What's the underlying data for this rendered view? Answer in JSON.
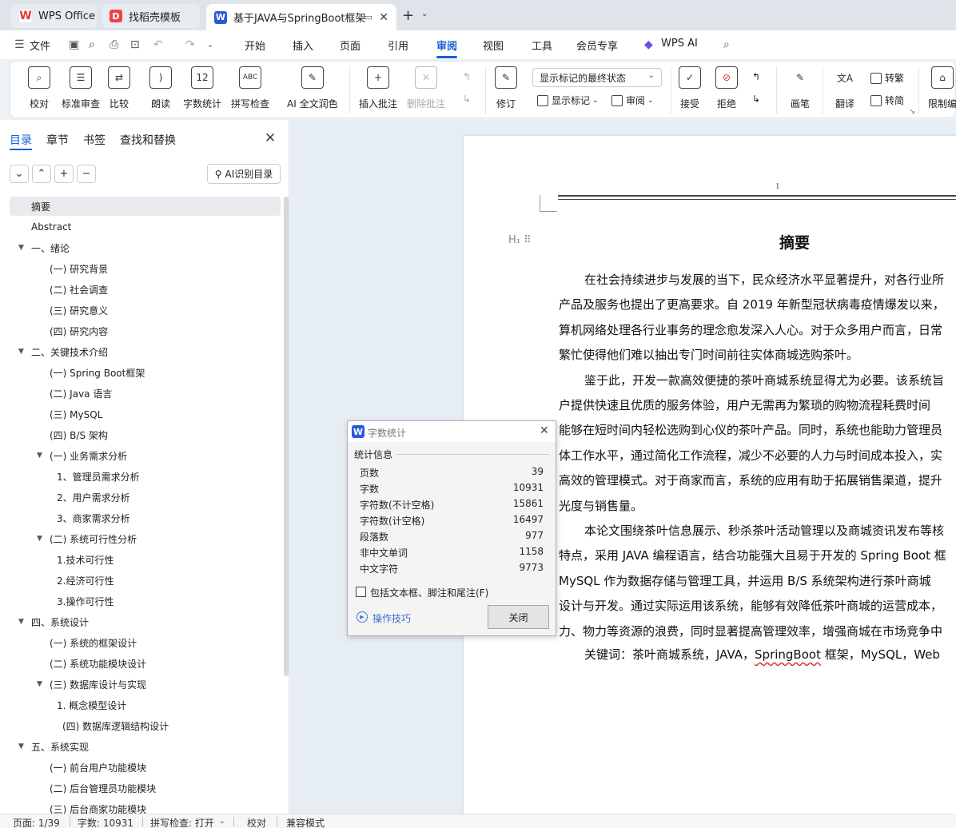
{
  "tabs": [
    {
      "label": "WPS Office",
      "icon": "wps-logo-icon"
    },
    {
      "label": "找稻壳模板",
      "icon": "docer-icon"
    },
    {
      "label": "基于JAVA与SpringBoot框架",
      "icon": "writer-doc-icon"
    }
  ],
  "menu": {
    "file": "文件",
    "items": [
      "开始",
      "插入",
      "页面",
      "引用",
      "审阅",
      "视图",
      "工具",
      "会员专享"
    ],
    "active": "审阅",
    "ai": "WPS AI"
  },
  "ribbon": {
    "proofread": "校对",
    "standard_review": "标准审查",
    "compare": "比较",
    "read_aloud": "朗读",
    "word_count": "字数统计",
    "spell_check": "拼写检查",
    "ai_polish": "AI 全文润色",
    "insert_comment": "插入批注",
    "delete_comment": "删除批注",
    "track_changes": "修订",
    "markup_select": "显示标记的最终状态",
    "show_markup": "显示标记",
    "review": "审阅",
    "accept": "接受",
    "reject": "拒绝",
    "pen": "画笔",
    "translate": "翻译",
    "to_traditional": "转繁",
    "to_simplified": "转简",
    "restrict_edit": "限制编"
  },
  "nav": {
    "tabs": [
      "目录",
      "章节",
      "书签",
      "查找和替换"
    ],
    "active_tab": "目录",
    "ai_toc": "AI识别目录",
    "toc": [
      {
        "label": "摘要",
        "level": 1,
        "selected": true
      },
      {
        "label": "Abstract",
        "level": 1
      },
      {
        "label": "一、绪论",
        "level": 1,
        "expandable": true
      },
      {
        "label": "(一) 研究背景",
        "level": 2
      },
      {
        "label": "(二) 社会调查",
        "level": 2
      },
      {
        "label": "(三) 研究意义",
        "level": 2
      },
      {
        "label": "(四) 研究内容",
        "level": 2
      },
      {
        "label": "二、关键技术介绍",
        "level": 1,
        "expandable": true
      },
      {
        "label": "(一)    Spring Boot框架",
        "level": 2
      },
      {
        "label": "(二) Java 语言",
        "level": 2
      },
      {
        "label": "(三) MySQL",
        "level": 2
      },
      {
        "label": "(四) B/S 架构",
        "level": 2
      },
      {
        "label": "(一) 业务需求分析",
        "level": 2,
        "expandable": true
      },
      {
        "label": "1、管理员需求分析",
        "level": 3
      },
      {
        "label": "2、用户需求分析",
        "level": 3
      },
      {
        "label": "3、商家需求分析",
        "level": 3
      },
      {
        "label": "(二) 系统可行性分析",
        "level": 2,
        "expandable": true
      },
      {
        "label": "1.技术可行性",
        "level": 3
      },
      {
        "label": "2.经济可行性",
        "level": 3
      },
      {
        "label": "3.操作可行性",
        "level": 3
      },
      {
        "label": "四、系统设计",
        "level": 1,
        "expandable": true
      },
      {
        "label": "(一) 系统的框架设计",
        "level": 2
      },
      {
        "label": "(二) 系统功能模块设计",
        "level": 2
      },
      {
        "label": "(三)    数据库设计与实现",
        "level": 2,
        "expandable": true
      },
      {
        "label": "1. 概念模型设计",
        "level": 3
      },
      {
        "label": "(四) 数据库逻辑结构设计",
        "level": 3.3
      },
      {
        "label": "五、系统实现",
        "level": 1,
        "expandable": true
      },
      {
        "label": "(一) 前台用户功能模块",
        "level": 2
      },
      {
        "label": "(二) 后台管理员功能模块",
        "level": 2
      },
      {
        "label": "(三) 后台商家功能模块",
        "level": 2
      }
    ]
  },
  "document": {
    "header_page_num": "1",
    "title": "摘要",
    "lines": [
      {
        "text": "在社会持续进步与发展的当下，民众经济水平显著提升，对各行业所",
        "indent": true
      },
      {
        "text": "产品及服务也提出了更高要求。自 2019 年新型冠状病毒疫情爆发以来，",
        "indent": false
      },
      {
        "text": "算机网络处理各行业事务的理念愈发深入人心。对于众多用户而言，日常",
        "indent": false
      },
      {
        "text": "繁忙使得他们难以抽出专门时间前往实体商城选购茶叶。",
        "indent": false
      },
      {
        "text": "鉴于此，开发一款高效便捷的茶叶商城系统显得尤为必要。该系统旨",
        "indent": true
      },
      {
        "text": "户提供快速且优质的服务体验，用户无需再为繁琐的购物流程耗费时间",
        "indent": false
      },
      {
        "text": "能够在短时间内轻松选购到心仪的茶叶产品。同时，系统也能助力管理员",
        "indent": false
      },
      {
        "text": "体工作水平，通过简化工作流程，减少不必要的人力与时间成本投入，实",
        "indent": false
      },
      {
        "text": "高效的管理模式。对于商家而言，系统的应用有助于拓展销售渠道，提升",
        "indent": false
      },
      {
        "text": "光度与销售量。",
        "indent": false
      },
      {
        "text": "本论文围绕茶叶信息展示、秒杀茶叶活动管理以及商城资讯发布等核",
        "indent": true
      },
      {
        "text": "特点，采用 JAVA 编程语言，结合功能强大且易于开发的 Spring Boot 框",
        "indent": false
      },
      {
        "text": "MySQL 作为数据存储与管理工具，并运用 B/S 系统架构进行茶叶商城",
        "indent": false
      },
      {
        "text": "设计与开发。通过实际运用该系统，能够有效降低茶叶商城的运营成本，",
        "indent": false
      },
      {
        "text": "力、物力等资源的浪费，同时显著提高管理效率，增强商城在市场竞争中",
        "indent": false
      }
    ],
    "keywords_prefix": "关键词：茶叶商城系统，JAVA，",
    "keywords_underlined": "SpringBoot",
    "keywords_suffix": " 框架，MySQL，Web"
  },
  "word_count_dialog": {
    "title": "字数统计",
    "group_label": "统计信息",
    "rows": [
      {
        "label": "页数",
        "value": "39"
      },
      {
        "label": "字数",
        "value": "10931"
      },
      {
        "label": "字符数(不计空格)",
        "value": "15861"
      },
      {
        "label": "字符数(计空格)",
        "value": "16497"
      },
      {
        "label": "段落数",
        "value": "977"
      },
      {
        "label": "非中文单词",
        "value": "1158"
      },
      {
        "label": "中文字符",
        "value": "9773"
      }
    ],
    "checkbox_label": "包括文本框、脚注和尾注(F)",
    "tips": "操作技巧",
    "close_button": "关闭"
  },
  "status": {
    "page": "页面: 1/39",
    "words": "字数: 10931",
    "spell": "拼写检查: 打开",
    "proof": "校对",
    "compat": "兼容模式"
  }
}
